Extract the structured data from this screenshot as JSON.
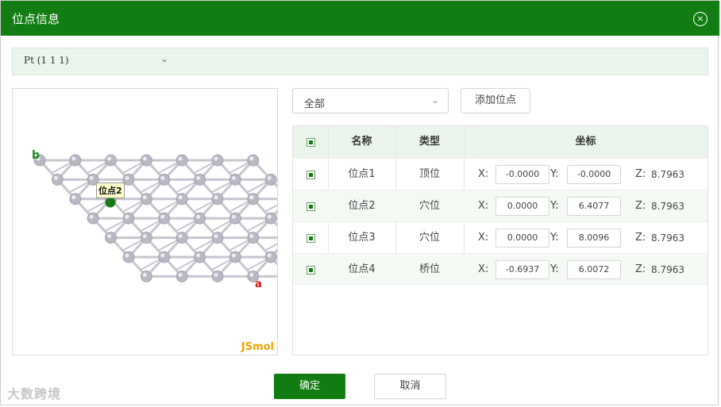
{
  "dialog": {
    "title": "位点信息",
    "close_icon": "×"
  },
  "crystal": {
    "selected": "Pt (1 1 1)"
  },
  "viewer": {
    "brand": "JSmol",
    "axis_b": "b",
    "axis_a": "a",
    "tag": "位点2",
    "colors": {
      "atom": "#b9b9c4",
      "bond": "#c6c6cf",
      "selected_site": "#1a7a1a"
    }
  },
  "filter": {
    "selected": "全部"
  },
  "add_button": "添加位点",
  "table": {
    "headers": {
      "name": "名称",
      "type": "类型",
      "coords": "坐标"
    },
    "axis_labels": {
      "x": "X:",
      "y": "Y:",
      "z": "Z:"
    },
    "rows": [
      {
        "name": "位点1",
        "type": "顶位",
        "x": "-0.0000",
        "y": "-0.0000",
        "z": "8.7963"
      },
      {
        "name": "位点2",
        "type": "穴位",
        "x": "0.0000",
        "y": "6.4077",
        "z": "8.7963"
      },
      {
        "name": "位点3",
        "type": "穴位",
        "x": "0.0000",
        "y": "8.0096",
        "z": "8.7963"
      },
      {
        "name": "位点4",
        "type": "桥位",
        "x": "-0.6937",
        "y": "6.0072",
        "z": "8.7963"
      }
    ]
  },
  "buttons": {
    "ok": "确定",
    "cancel": "取消"
  },
  "watermark": "大数跨境",
  "accent": "#127d12"
}
